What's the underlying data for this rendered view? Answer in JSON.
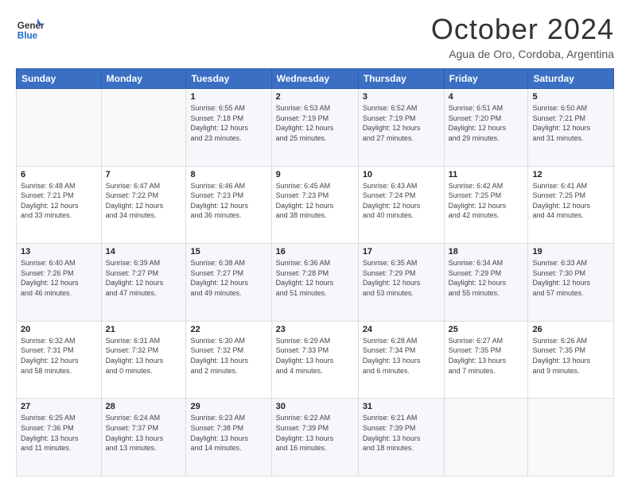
{
  "header": {
    "title": "October 2024",
    "location": "Agua de Oro, Cordoba, Argentina"
  },
  "columns": [
    "Sunday",
    "Monday",
    "Tuesday",
    "Wednesday",
    "Thursday",
    "Friday",
    "Saturday"
  ],
  "weeks": [
    [
      {
        "day": "",
        "info": ""
      },
      {
        "day": "",
        "info": ""
      },
      {
        "day": "1",
        "info": "Sunrise: 6:55 AM\nSunset: 7:18 PM\nDaylight: 12 hours\nand 23 minutes."
      },
      {
        "day": "2",
        "info": "Sunrise: 6:53 AM\nSunset: 7:19 PM\nDaylight: 12 hours\nand 25 minutes."
      },
      {
        "day": "3",
        "info": "Sunrise: 6:52 AM\nSunset: 7:19 PM\nDaylight: 12 hours\nand 27 minutes."
      },
      {
        "day": "4",
        "info": "Sunrise: 6:51 AM\nSunset: 7:20 PM\nDaylight: 12 hours\nand 29 minutes."
      },
      {
        "day": "5",
        "info": "Sunrise: 6:50 AM\nSunset: 7:21 PM\nDaylight: 12 hours\nand 31 minutes."
      }
    ],
    [
      {
        "day": "6",
        "info": "Sunrise: 6:48 AM\nSunset: 7:21 PM\nDaylight: 12 hours\nand 33 minutes."
      },
      {
        "day": "7",
        "info": "Sunrise: 6:47 AM\nSunset: 7:22 PM\nDaylight: 12 hours\nand 34 minutes."
      },
      {
        "day": "8",
        "info": "Sunrise: 6:46 AM\nSunset: 7:23 PM\nDaylight: 12 hours\nand 36 minutes."
      },
      {
        "day": "9",
        "info": "Sunrise: 6:45 AM\nSunset: 7:23 PM\nDaylight: 12 hours\nand 38 minutes."
      },
      {
        "day": "10",
        "info": "Sunrise: 6:43 AM\nSunset: 7:24 PM\nDaylight: 12 hours\nand 40 minutes."
      },
      {
        "day": "11",
        "info": "Sunrise: 6:42 AM\nSunset: 7:25 PM\nDaylight: 12 hours\nand 42 minutes."
      },
      {
        "day": "12",
        "info": "Sunrise: 6:41 AM\nSunset: 7:25 PM\nDaylight: 12 hours\nand 44 minutes."
      }
    ],
    [
      {
        "day": "13",
        "info": "Sunrise: 6:40 AM\nSunset: 7:26 PM\nDaylight: 12 hours\nand 46 minutes."
      },
      {
        "day": "14",
        "info": "Sunrise: 6:39 AM\nSunset: 7:27 PM\nDaylight: 12 hours\nand 47 minutes."
      },
      {
        "day": "15",
        "info": "Sunrise: 6:38 AM\nSunset: 7:27 PM\nDaylight: 12 hours\nand 49 minutes."
      },
      {
        "day": "16",
        "info": "Sunrise: 6:36 AM\nSunset: 7:28 PM\nDaylight: 12 hours\nand 51 minutes."
      },
      {
        "day": "17",
        "info": "Sunrise: 6:35 AM\nSunset: 7:29 PM\nDaylight: 12 hours\nand 53 minutes."
      },
      {
        "day": "18",
        "info": "Sunrise: 6:34 AM\nSunset: 7:29 PM\nDaylight: 12 hours\nand 55 minutes."
      },
      {
        "day": "19",
        "info": "Sunrise: 6:33 AM\nSunset: 7:30 PM\nDaylight: 12 hours\nand 57 minutes."
      }
    ],
    [
      {
        "day": "20",
        "info": "Sunrise: 6:32 AM\nSunset: 7:31 PM\nDaylight: 12 hours\nand 58 minutes."
      },
      {
        "day": "21",
        "info": "Sunrise: 6:31 AM\nSunset: 7:32 PM\nDaylight: 13 hours\nand 0 minutes."
      },
      {
        "day": "22",
        "info": "Sunrise: 6:30 AM\nSunset: 7:32 PM\nDaylight: 13 hours\nand 2 minutes."
      },
      {
        "day": "23",
        "info": "Sunrise: 6:29 AM\nSunset: 7:33 PM\nDaylight: 13 hours\nand 4 minutes."
      },
      {
        "day": "24",
        "info": "Sunrise: 6:28 AM\nSunset: 7:34 PM\nDaylight: 13 hours\nand 6 minutes."
      },
      {
        "day": "25",
        "info": "Sunrise: 6:27 AM\nSunset: 7:35 PM\nDaylight: 13 hours\nand 7 minutes."
      },
      {
        "day": "26",
        "info": "Sunrise: 6:26 AM\nSunset: 7:35 PM\nDaylight: 13 hours\nand 9 minutes."
      }
    ],
    [
      {
        "day": "27",
        "info": "Sunrise: 6:25 AM\nSunset: 7:36 PM\nDaylight: 13 hours\nand 11 minutes."
      },
      {
        "day": "28",
        "info": "Sunrise: 6:24 AM\nSunset: 7:37 PM\nDaylight: 13 hours\nand 13 minutes."
      },
      {
        "day": "29",
        "info": "Sunrise: 6:23 AM\nSunset: 7:38 PM\nDaylight: 13 hours\nand 14 minutes."
      },
      {
        "day": "30",
        "info": "Sunrise: 6:22 AM\nSunset: 7:39 PM\nDaylight: 13 hours\nand 16 minutes."
      },
      {
        "day": "31",
        "info": "Sunrise: 6:21 AM\nSunset: 7:39 PM\nDaylight: 13 hours\nand 18 minutes."
      },
      {
        "day": "",
        "info": ""
      },
      {
        "day": "",
        "info": ""
      }
    ]
  ]
}
